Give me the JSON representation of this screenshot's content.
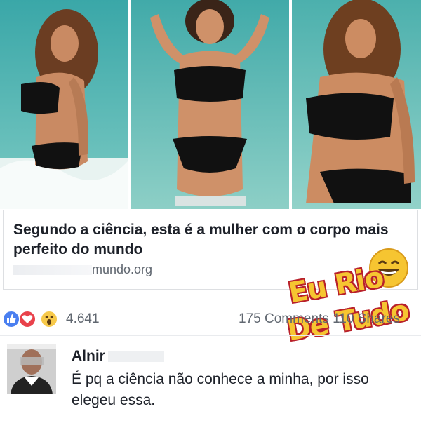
{
  "post": {
    "images": [
      {
        "name": "photo-1"
      },
      {
        "name": "photo-2"
      },
      {
        "name": "photo-3"
      }
    ],
    "headline": "Segundo a ciência, esta é a mulher com o corpo mais perfeito do mundo",
    "source_domain": "mundo.org"
  },
  "reactions": {
    "icons": [
      "like-icon",
      "love-icon",
      "wow-icon"
    ],
    "count": "4.641",
    "summary": "175 Comments 110 Shares"
  },
  "comment": {
    "author": "Alnir",
    "text": "É pq a ciência não conhece a minha, por isso elegeu essa."
  },
  "watermark": {
    "line1": "Eu Rio",
    "line2": "De Tudo"
  },
  "colors": {
    "like": "#4a7ff0",
    "love": "#e9424b",
    "wow": "#f7c94a",
    "watermark_fill": "#f6c531",
    "watermark_outline": "#b8202a"
  }
}
